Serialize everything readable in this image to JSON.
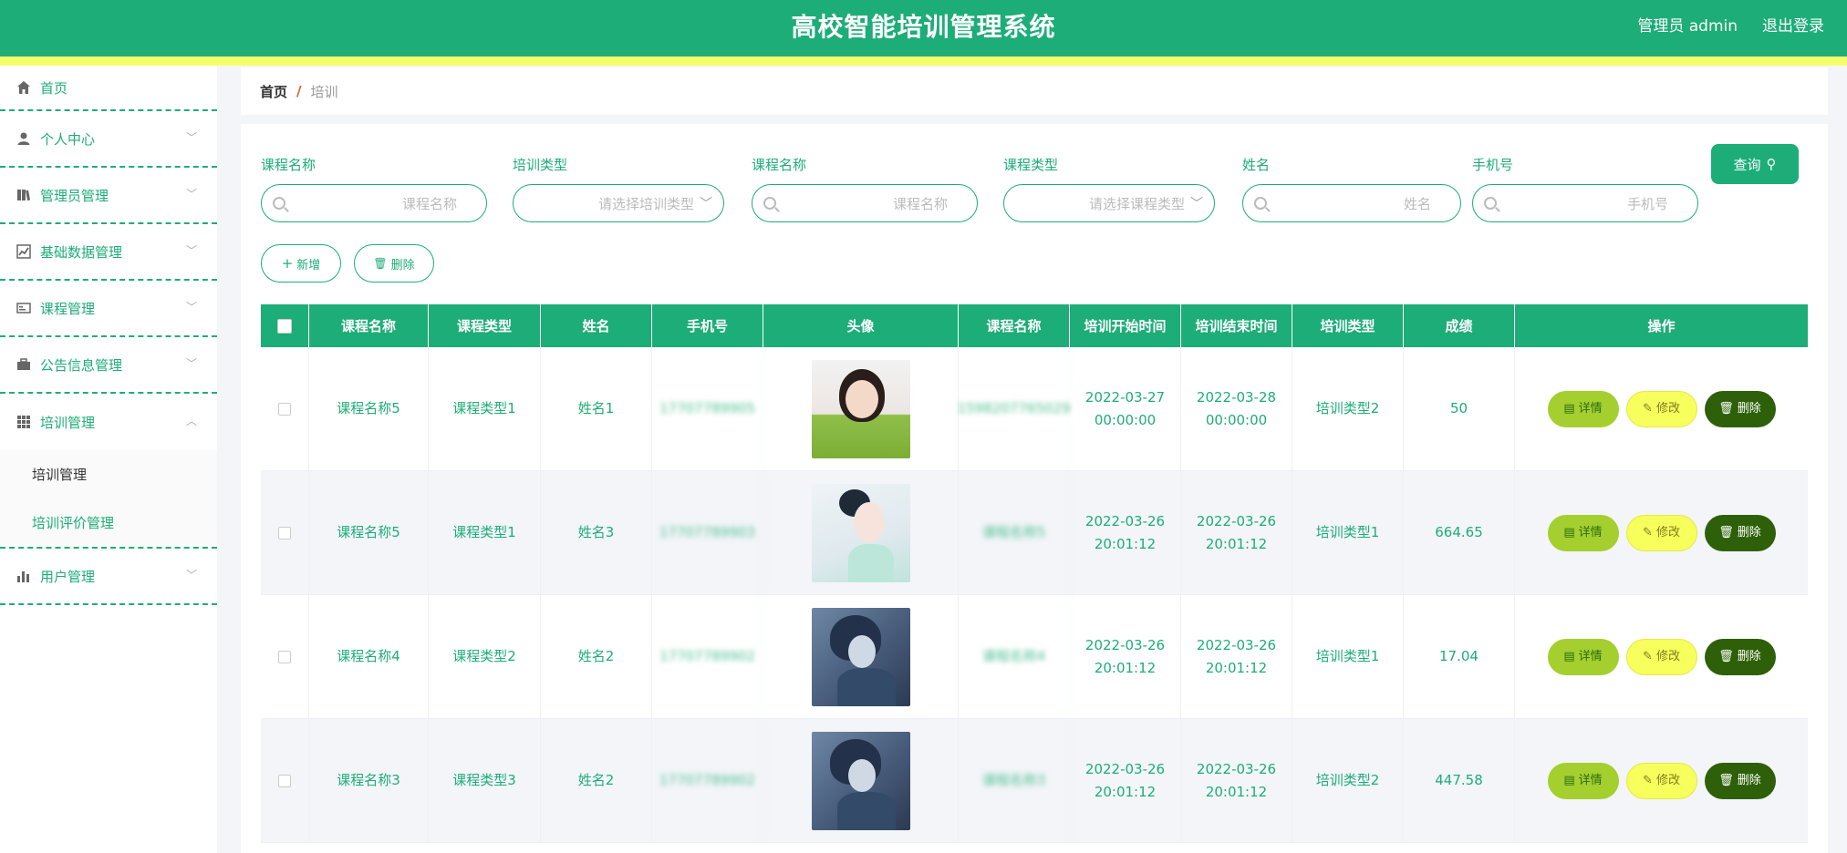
{
  "header": {
    "title": "高校智能培训管理系统",
    "user": "管理员 admin",
    "logout": "退出登录"
  },
  "sidebar": {
    "items": [
      {
        "label": "首页",
        "icon": "home-icon"
      },
      {
        "label": "个人中心",
        "icon": "user-icon"
      },
      {
        "label": "管理员管理",
        "icon": "book-icon"
      },
      {
        "label": "基础数据管理",
        "icon": "chart-icon"
      },
      {
        "label": "课程管理",
        "icon": "card-icon"
      },
      {
        "label": "公告信息管理",
        "icon": "briefcase-icon"
      },
      {
        "label": "培训管理",
        "icon": "grid-icon"
      },
      {
        "label": "用户管理",
        "icon": "bar-icon"
      }
    ],
    "submenu": [
      "培训管理",
      "培训评价管理"
    ]
  },
  "breadcrumb": {
    "home": "首页",
    "sep": "/",
    "current": "培训"
  },
  "filters": [
    {
      "label": "课程名称",
      "placeholder": "课程名称"
    },
    {
      "label": "培训类型",
      "placeholder": "请选择培训类型"
    },
    {
      "label": "课程名称",
      "placeholder": "课程名称"
    },
    {
      "label": "课程类型",
      "placeholder": "请选择课程类型"
    },
    {
      "label": "姓名",
      "placeholder": "姓名"
    },
    {
      "label": "手机号",
      "placeholder": "手机号"
    }
  ],
  "buttons": {
    "query": "查询",
    "add": "新增",
    "delete": "删除"
  },
  "table": {
    "headers": [
      "课程名称",
      "课程类型",
      "姓名",
      "手机号",
      "头像",
      "课程名称",
      "培训开始时间",
      "培训结束时间",
      "培训类型",
      "成绩",
      "操作"
    ],
    "rows": [
      {
        "course": "课程名称5",
        "type": "课程类型1",
        "name": "姓名1",
        "phone": "17707789905",
        "course2": "1598207765029",
        "start": "2022-03-27 00:00:00",
        "end": "2022-03-28 00:00:00",
        "ttype": "培训类型2",
        "score": "50"
      },
      {
        "course": "课程名称5",
        "type": "课程类型1",
        "name": "姓名3",
        "phone": "17707789903",
        "course2": "课程名称5",
        "start": "2022-03-26 20:01:12",
        "end": "2022-03-26 20:01:12",
        "ttype": "培训类型1",
        "score": "664.65"
      },
      {
        "course": "课程名称4",
        "type": "课程类型2",
        "name": "姓名2",
        "phone": "17707789902",
        "course2": "课程名称4",
        "start": "2022-03-26 20:01:12",
        "end": "2022-03-26 20:01:12",
        "ttype": "培训类型1",
        "score": "17.04"
      },
      {
        "course": "课程名称3",
        "type": "课程类型3",
        "name": "姓名2",
        "phone": "17707789902",
        "course2": "课程名称3",
        "start": "2022-03-26 20:01:12",
        "end": "2022-03-26 20:01:12",
        "ttype": "培训类型2",
        "score": "447.58"
      }
    ],
    "actions": {
      "detail": "详情",
      "edit": "修改",
      "delete": "删除"
    }
  }
}
